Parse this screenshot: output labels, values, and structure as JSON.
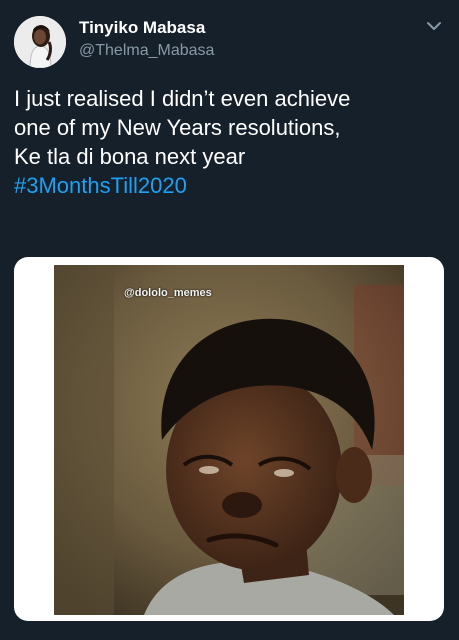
{
  "tweet": {
    "author_name": "Tinyiko Mabasa",
    "author_handle": "@Thelma_Mabasa",
    "text_lines": [
      "I just realised I didn’t even achieve",
      "one of my New Years resolutions,",
      "Ke tla di bona next year"
    ],
    "hashtag": "#3MonthsTill2020"
  },
  "media": {
    "watermark": "@dololo_memes"
  },
  "icons": {
    "more_menu": "chevron-down-icon",
    "avatar": "profile-avatar"
  },
  "colors": {
    "background": "#15202b",
    "text": "#ffffff",
    "secondary": "#8899a6",
    "link": "#1da1f2"
  }
}
